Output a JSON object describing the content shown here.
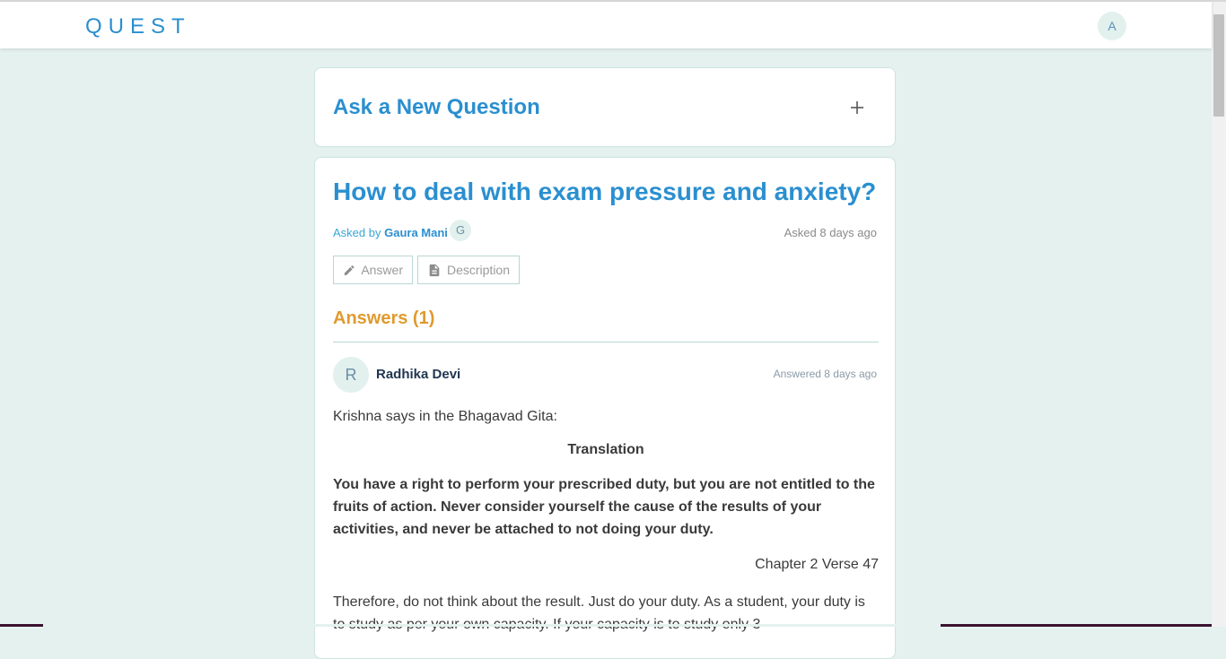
{
  "app": {
    "brand": "QUEST",
    "user_initial": "A"
  },
  "ask": {
    "title": "Ask a New Question",
    "icon": "plus-icon"
  },
  "question": {
    "title": "How to deal with exam pressure and anxiety?",
    "asked_by_prefix": "Asked by",
    "asker": "Gaura Mani",
    "asker_initial": "G",
    "asked_time": "Asked 8 days ago",
    "buttons": {
      "answer": "Answer",
      "description": "Description"
    }
  },
  "answers": {
    "heading": "Answers (1)",
    "items": [
      {
        "initial": "R",
        "author": "Radhika Devi",
        "time": "Answered 8 days ago",
        "intro": "Krishna says in the Bhagavad Gita:",
        "subheading": "Translation",
        "verse": "You have a right to perform your prescribed duty, but you are not entitled to the fruits of action. Never consider yourself the cause of the results of your activities, and never be attached to not doing your duty.",
        "reference": "Chapter 2 Verse 47",
        "text": "Therefore, do not think about the result. Just do your duty. As a student, your duty is to study as per your own capacity. If your capacity is to study only 3"
      }
    ]
  },
  "colors": {
    "background": "#e4f1ee",
    "primary": "#2a8fd0",
    "answers_accent": "#e09a2e"
  }
}
